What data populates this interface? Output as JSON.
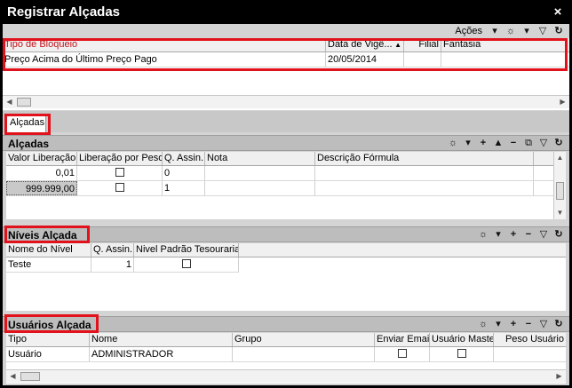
{
  "window": {
    "title": "Registrar Alçadas",
    "close": "×"
  },
  "top_toolbar": {
    "acoes_label": "Ações"
  },
  "bloqueio_grid": {
    "columns": [
      "Tipo de Bloqueio",
      "Data de Vigê...",
      "Filial",
      "Fantasia"
    ],
    "rows": [
      {
        "tipo": "Preço Acima do Último Preço Pago",
        "data": "20/05/2014",
        "filial": "",
        "fantasia": ""
      }
    ]
  },
  "tabs": [
    {
      "label": "Alçadas"
    }
  ],
  "alcadas": {
    "title": "Alçadas",
    "columns": [
      "Valor Liberação",
      "Liberação por Peso",
      "Q. Assin.",
      "Nota",
      "Descrição Fórmula"
    ],
    "rows": [
      {
        "valor": "0,01",
        "assin": "0",
        "nota": "",
        "descricao": ""
      },
      {
        "valor": "999.999,00",
        "assin": "1",
        "nota": "",
        "descricao": ""
      }
    ]
  },
  "niveis": {
    "title": "Níveis Alçada",
    "columns": [
      "Nome do Nível",
      "Q. Assin.",
      "Nivel Padrão Tesouraria"
    ],
    "rows": [
      {
        "nome": "Teste",
        "assin": "1"
      }
    ]
  },
  "usuarios": {
    "title": "Usuários Alçada",
    "columns": [
      "Tipo",
      "Nome",
      "Grupo",
      "Enviar Email",
      "Usuário Master",
      "Peso Usuário"
    ],
    "rows": [
      {
        "tipo": "Usuário",
        "nome": "ADMINISTRADOR",
        "grupo": ""
      }
    ]
  },
  "colors": {
    "highlight": "#e1121b",
    "title_bg": "#000000",
    "section_bg": "#bdbdbd"
  },
  "icons": [
    "dropdown-arrow-icon",
    "visibility-icon",
    "filter-icon",
    "refresh-icon",
    "add-icon",
    "move-up-icon",
    "remove-icon",
    "export-icon",
    "scroll-left-icon",
    "scroll-right-icon",
    "scroll-up-icon",
    "scroll-down-icon",
    "close-icon"
  ]
}
